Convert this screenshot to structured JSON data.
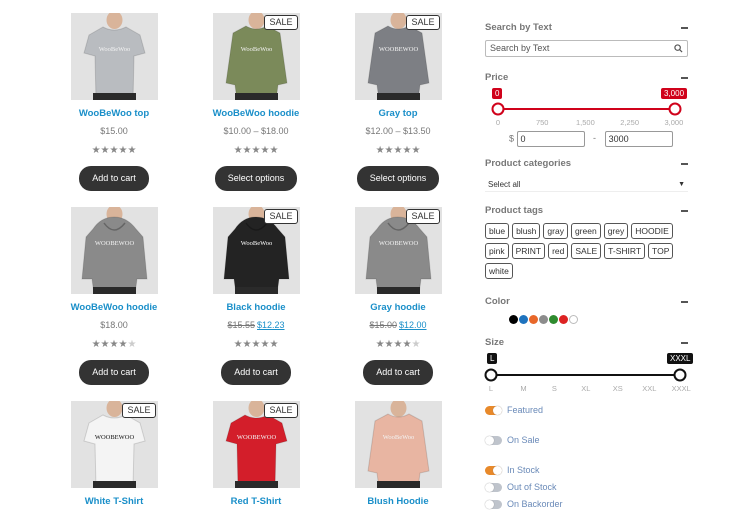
{
  "products": [
    {
      "name": "WooBeWoo top",
      "price": "$15.00",
      "old_price": "",
      "new_price": "",
      "sale": false,
      "rating": 5,
      "button": "Add to cart",
      "shirt_color": "#b9bcc0",
      "print": "WooBeWoo",
      "type": "tshirt",
      "bg": "#e2e2e2"
    },
    {
      "name": "WooBeWoo hoodie",
      "price": "$10.00 – $18.00",
      "old_price": "",
      "new_price": "",
      "sale": true,
      "rating": 5,
      "button": "Select options",
      "shirt_color": "#7b8a5a",
      "print": "WooBeWoo",
      "type": "sweater",
      "bg": "#e2e2e2"
    },
    {
      "name": "Gray top",
      "price": "$12.00 – $13.50",
      "old_price": "",
      "new_price": "",
      "sale": true,
      "rating": 5,
      "button": "Select options",
      "shirt_color": "#7d7f84",
      "print": "WOOBEWOO",
      "type": "sweater",
      "bg": "#e2e2e2"
    },
    {
      "name": "WooBeWoo hoodie",
      "price": "$18.00",
      "old_price": "",
      "new_price": "",
      "sale": false,
      "rating": 4,
      "button": "Add to cart",
      "shirt_color": "#8a8a8a",
      "print": "WOOBEWOO",
      "type": "hoodie",
      "bg": "#e2e2e2"
    },
    {
      "name": "Black hoodie",
      "price": "",
      "old_price": "$15.55",
      "new_price": "$12.23",
      "sale": true,
      "rating": 5,
      "button": "Add to cart",
      "shirt_color": "#232323",
      "print": "WooBeWoo",
      "type": "hoodie",
      "bg": "#e2e2e2"
    },
    {
      "name": "Gray hoodie",
      "price": "",
      "old_price": "$15.00",
      "new_price": "$12.00",
      "sale": true,
      "rating": 4,
      "button": "Add to cart",
      "shirt_color": "#8a8a8a",
      "print": "WOOBEWOO",
      "type": "hoodie",
      "bg": "#e2e2e2"
    },
    {
      "name": "White T-Shirt",
      "price": "",
      "old_price": "",
      "new_price": "",
      "sale": true,
      "rating": 0,
      "button": "",
      "shirt_color": "#f4f4f4",
      "print": "WOOBEWOO",
      "type": "tshirt",
      "bg": "#e2e2e2"
    },
    {
      "name": "Red T-Shirt",
      "price": "",
      "old_price": "",
      "new_price": "",
      "sale": true,
      "rating": 0,
      "button": "",
      "shirt_color": "#d31e2a",
      "print": "WOOBEWOO",
      "type": "tshirt",
      "bg": "#e2e2e2"
    },
    {
      "name": "Blush Hoodie",
      "price": "",
      "old_price": "",
      "new_price": "",
      "sale": false,
      "rating": 0,
      "button": "",
      "shirt_color": "#e8b5a2",
      "print": "WooBeWoo",
      "type": "sweater",
      "bg": "#e2e2e2"
    }
  ],
  "sale_label": "SALE",
  "sidebar": {
    "search": {
      "title": "Search by Text",
      "placeholder": "Search by Text"
    },
    "price": {
      "title": "Price",
      "min_badge": "0",
      "max_badge": "3,000",
      "ticks": [
        "0",
        "750",
        "1,500",
        "2,250",
        "3,000"
      ],
      "currency": "$",
      "min_value": "0",
      "max_value": "3000",
      "separator": "-",
      "accent": "#d0021b"
    },
    "categories": {
      "title": "Product categories",
      "selected": "Select all"
    },
    "tags": {
      "title": "Product tags",
      "items": [
        "blue",
        "blush",
        "gray",
        "green",
        "grey",
        "HOODIE",
        "pink",
        "PRINT",
        "red",
        "SALE",
        "T-SHIRT",
        "TOP",
        "white"
      ]
    },
    "color": {
      "title": "Color",
      "swatches": [
        "#000000",
        "#1e73be",
        "#e8672a",
        "#8c8c8c",
        "#2e8b2e",
        "#dd2222",
        "#ffffff"
      ]
    },
    "size": {
      "title": "Size",
      "min_badge": "L",
      "max_badge": "XXXL",
      "ticks": [
        "L",
        "M",
        "S",
        "XL",
        "XS",
        "XXL",
        "XXXL"
      ]
    },
    "toggles": [
      {
        "label": "Featured",
        "on": true
      },
      {
        "label": "On Sale",
        "on": false
      },
      {
        "label": "In Stock",
        "on": true
      },
      {
        "label": "Out of Stock",
        "on": false
      },
      {
        "label": "On Backorder",
        "on": false
      }
    ],
    "toggle_on_color": "#e8892a",
    "toggle_off_color": "#bfc4cc"
  }
}
